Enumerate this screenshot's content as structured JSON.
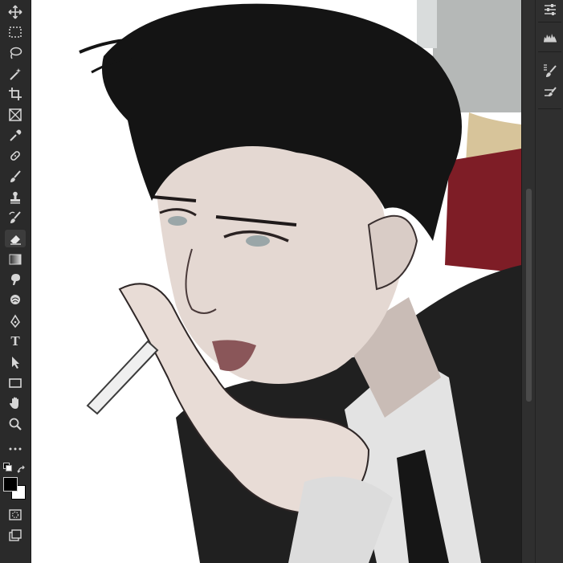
{
  "app": {
    "accent": "#3c3c3c",
    "panel_bg": "#2a2a2a"
  },
  "toolbar": {
    "tools": [
      {
        "icon": "move-icon"
      },
      {
        "icon": "rectangular-marquee-icon"
      },
      {
        "icon": "lasso-icon"
      },
      {
        "icon": "magic-wand-icon"
      },
      {
        "icon": "crop-icon"
      },
      {
        "icon": "frame-icon"
      },
      {
        "icon": "eyedropper-icon"
      },
      {
        "icon": "healing-brush-icon"
      },
      {
        "icon": "brush-icon"
      },
      {
        "icon": "clone-stamp-icon"
      },
      {
        "icon": "history-brush-icon"
      },
      {
        "icon": "eraser-icon",
        "active": true
      },
      {
        "icon": "gradient-icon"
      },
      {
        "icon": "smudge-icon"
      },
      {
        "icon": "dodge-icon"
      },
      {
        "icon": "pen-icon"
      },
      {
        "icon": "type-icon",
        "label": "T"
      },
      {
        "icon": "path-selection-icon"
      },
      {
        "icon": "rectangle-shape-icon"
      },
      {
        "icon": "hand-icon"
      },
      {
        "icon": "zoom-icon"
      },
      {
        "icon": "more-tools-icon"
      }
    ],
    "foreground_color": "#000000",
    "background_color": "#ffffff"
  },
  "right_panel": {
    "icons": [
      "adjustments-icon",
      "histogram-icon",
      "brush-settings-icon",
      "brush-presets-icon"
    ]
  }
}
